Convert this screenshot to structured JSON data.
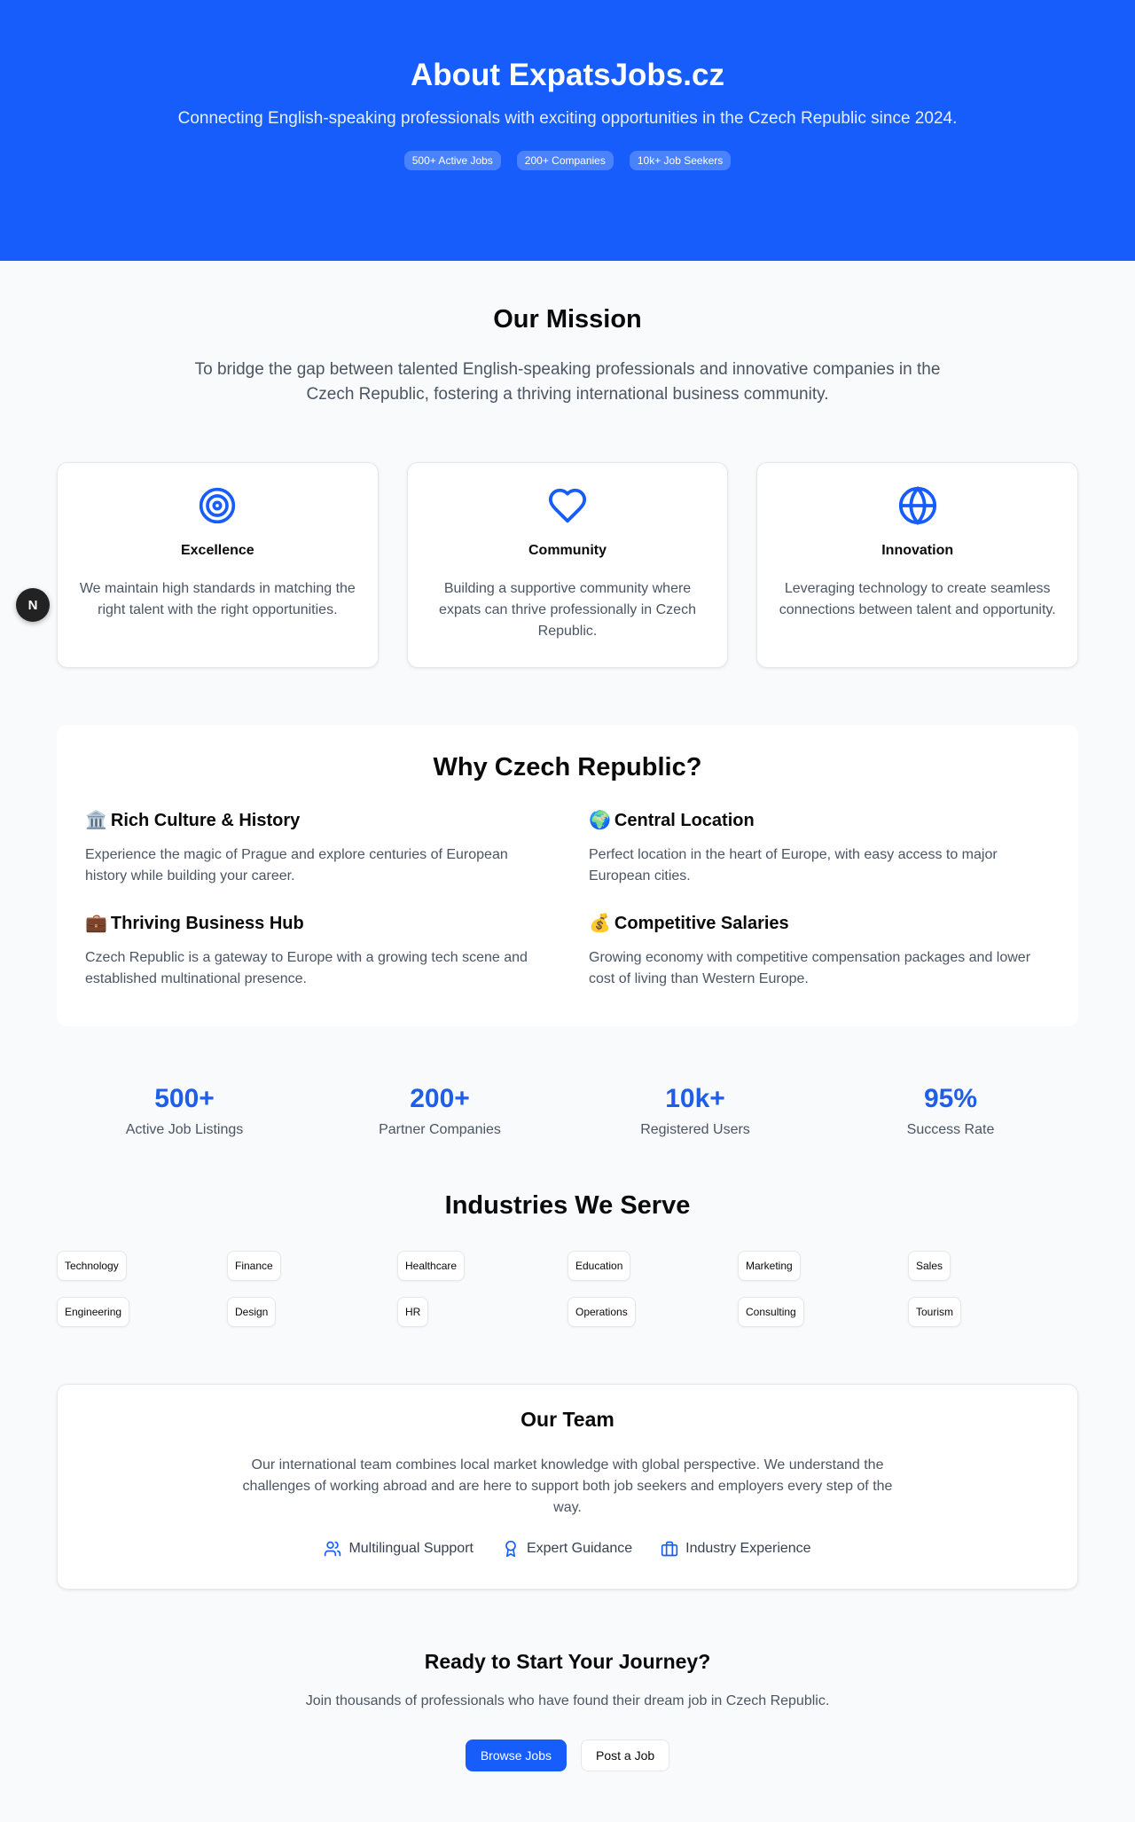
{
  "hero": {
    "title": "About ExpatsJobs.cz",
    "subtitle": "Connecting English-speaking professionals with exciting opportunities in the Czech Republic since 2024.",
    "badges": [
      "500+ Active Jobs",
      "200+ Companies",
      "10k+ Job Seekers"
    ]
  },
  "mission": {
    "title": "Our Mission",
    "lead": "To bridge the gap between talented English-speaking professionals and innovative companies in the Czech Republic, fostering a thriving international business community.",
    "values": [
      {
        "icon": "target-icon",
        "title": "Excellence",
        "text": "We maintain high standards in matching the right talent with the right opportunities."
      },
      {
        "icon": "heart-icon",
        "title": "Community",
        "text": "Building a supportive community where expats can thrive professionally in Czech Republic."
      },
      {
        "icon": "globe-icon",
        "title": "Innovation",
        "text": "Leveraging technology to create seamless connections between talent and opportunity."
      }
    ]
  },
  "dev_badge": "N",
  "why": {
    "title": "Why Czech Republic?",
    "items": [
      {
        "emoji": "🏛️",
        "title": "Rich Culture & History",
        "text": "Experience the magic of Prague and explore centuries of European history while building your career."
      },
      {
        "emoji": "🌍",
        "title": "Central Location",
        "text": "Perfect location in the heart of Europe, with easy access to major European cities."
      },
      {
        "emoji": "💼",
        "title": "Thriving Business Hub",
        "text": "Czech Republic is a gateway to Europe with a growing tech scene and established multinational presence."
      },
      {
        "emoji": "💰",
        "title": "Competitive Salaries",
        "text": "Growing economy with competitive compensation packages and lower cost of living than Western Europe."
      }
    ]
  },
  "stats": [
    {
      "value": "500+",
      "label": "Active Job Listings"
    },
    {
      "value": "200+",
      "label": "Partner Companies"
    },
    {
      "value": "10k+",
      "label": "Registered Users"
    },
    {
      "value": "95%",
      "label": "Success Rate"
    }
  ],
  "industries": {
    "title": "Industries We Serve",
    "items": [
      "Technology",
      "Finance",
      "Healthcare",
      "Education",
      "Marketing",
      "Sales",
      "Engineering",
      "Design",
      "HR",
      "Operations",
      "Consulting",
      "Tourism"
    ]
  },
  "team": {
    "title": "Our Team",
    "text": "Our international team combines local market knowledge with global perspective. We understand the challenges of working abroad and are here to support both job seekers and employers every step of the way.",
    "features": [
      {
        "icon": "users-icon",
        "label": "Multilingual Support"
      },
      {
        "icon": "award-icon",
        "label": "Expert Guidance"
      },
      {
        "icon": "briefcase-icon",
        "label": "Industry Experience"
      }
    ]
  },
  "cta": {
    "title": "Ready to Start Your Journey?",
    "text": "Join thousands of professionals who have found their dream job in Czech Republic.",
    "browse_label": "Browse Jobs",
    "post_label": "Post a Job"
  },
  "colors": {
    "brand": "#165dfb",
    "accent_text": "#1e5ee8"
  }
}
